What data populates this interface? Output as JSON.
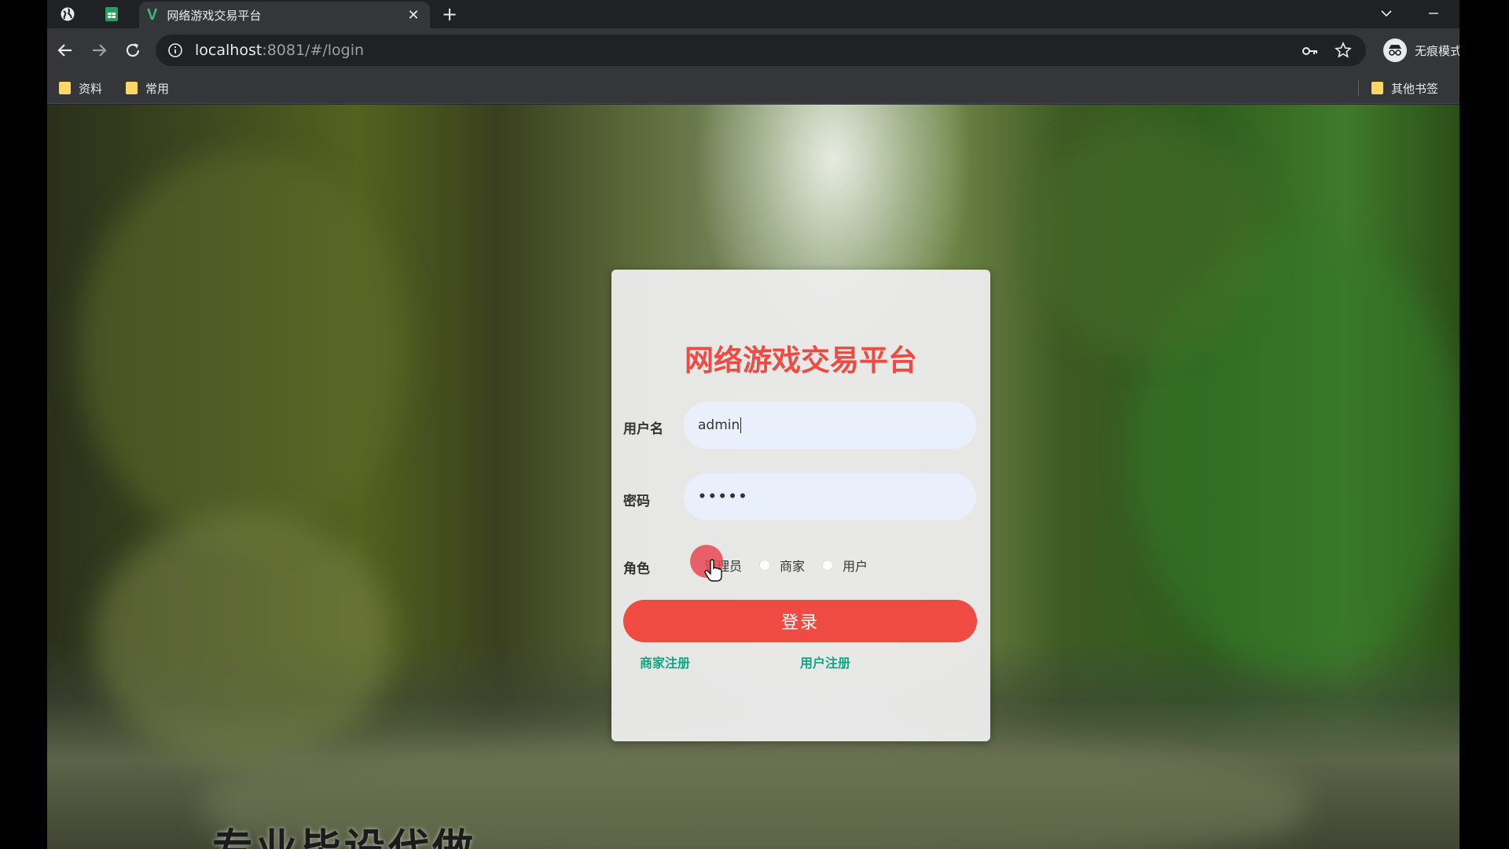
{
  "browser": {
    "active_tab_title": "网络游戏交易平台",
    "url_host": "localhost",
    "url_rest": ":8081/#/login",
    "profile_label": "无痕模式",
    "bookmarks": [
      {
        "label": "资料"
      },
      {
        "label": "常用"
      }
    ],
    "other_bookmarks_label": "其他书签"
  },
  "login": {
    "title": "网络游戏交易平台",
    "username_label": "用户名",
    "username_value": "admin",
    "password_label": "密码",
    "password_value": "•••••",
    "role_label": "角色",
    "roles": [
      "管理员",
      "商家",
      "用户"
    ],
    "login_button": "登录",
    "merchant_register": "商家注册",
    "user_register": "用户注册"
  },
  "overlay": {
    "subtitle": "专业毕设代做"
  },
  "colors": {
    "accent": "#ef4b43",
    "link": "#11a683",
    "input_bg": "#e9f0fb",
    "chrome_dark": "#202124",
    "chrome_toolbar": "#35363a"
  }
}
